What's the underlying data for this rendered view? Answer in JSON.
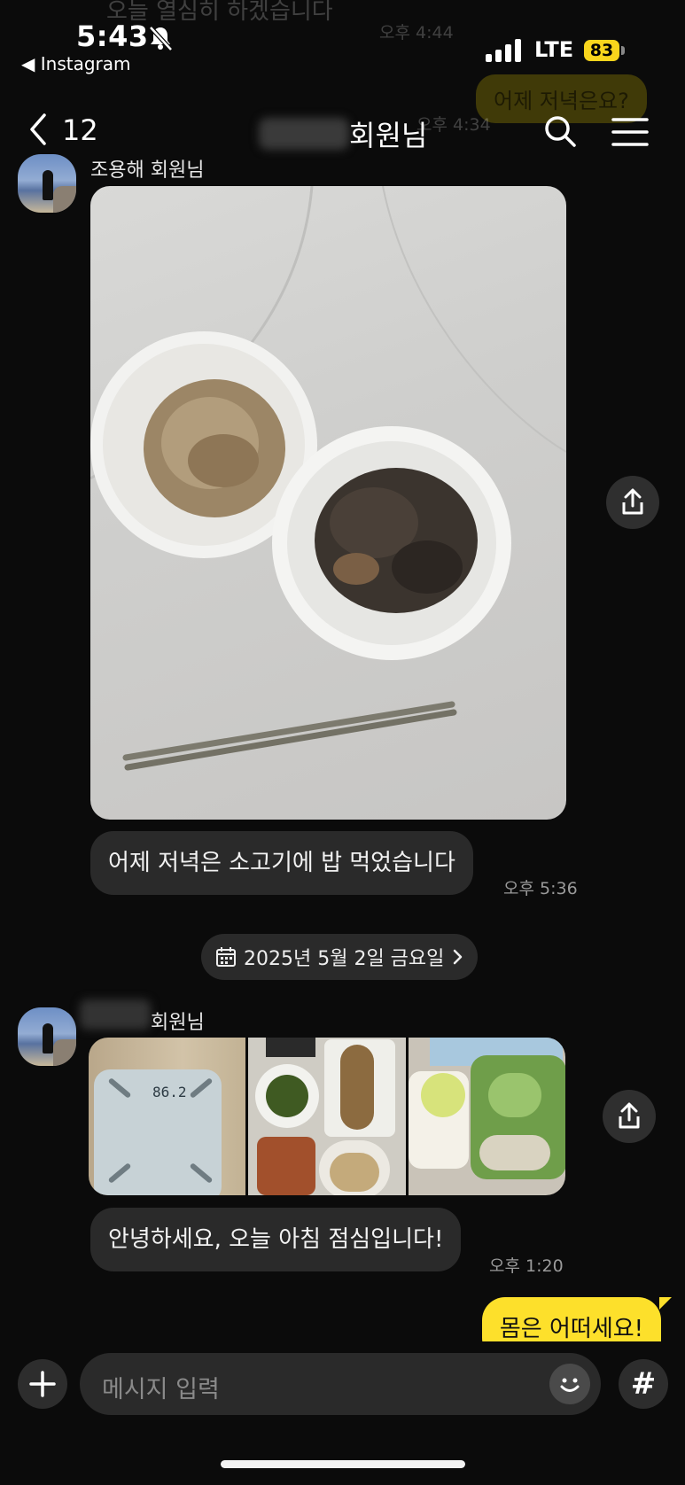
{
  "status": {
    "time": "5:43",
    "back_app": "◀ Instagram",
    "network": "LTE",
    "battery": "83"
  },
  "ghost": {
    "top_text": "오늘 열심히 하겠습니다",
    "top_time": "오후 4:44",
    "bubble": "어제 저녁은요?",
    "bubble_time": "오후 4:34"
  },
  "header": {
    "unread_count": "12",
    "title": "회원님"
  },
  "messages": {
    "first_sender": "조용해 회원님",
    "text1": "어제 저녁은 소고기에 밥 먹었습니다",
    "time1": "오후 5:36",
    "date_divider": "2025년 5월 2일 금요일",
    "second_sender": "회원님",
    "scale_reading": "86.2",
    "text2": "안녕하세요, 오늘 아침 점심입니다!",
    "time2": "오후 1:20",
    "my_reply": "몸은 어떠세요!"
  },
  "input": {
    "placeholder": "메시지 입력",
    "hash": "#"
  }
}
